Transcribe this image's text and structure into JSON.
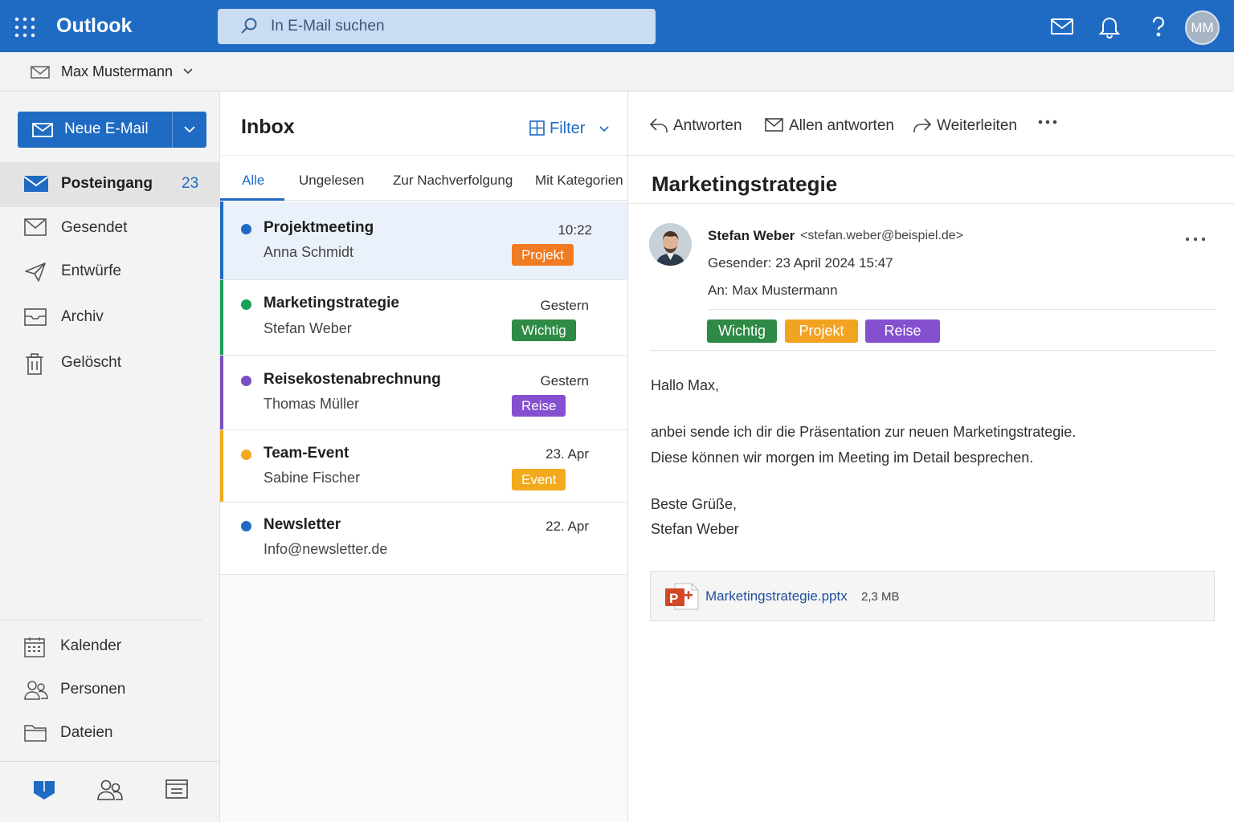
{
  "app": {
    "title": "Outlook"
  },
  "search": {
    "placeholder": "In E-Mail suchen"
  },
  "user": {
    "initials": "MM",
    "name": "Max Mustermann"
  },
  "nav": {
    "new_mail_label": "Neue E-Mail",
    "folders": [
      {
        "label": "Posteingang",
        "count": "23",
        "icon": "inbox-icon"
      },
      {
        "label": "Gesendet",
        "icon": "sent-icon"
      },
      {
        "label": "Entwürfe",
        "icon": "drafts-icon"
      },
      {
        "label": "Archiv",
        "icon": "archive-icon"
      },
      {
        "label": "Gelöscht",
        "icon": "trash-icon"
      }
    ],
    "apps": [
      {
        "label": "Kalender",
        "icon": "calendar-icon"
      },
      {
        "label": "Personen",
        "icon": "people-icon"
      },
      {
        "label": "Dateien",
        "icon": "folder-icon"
      }
    ]
  },
  "list": {
    "title": "Inbox",
    "filter_label": "Filter",
    "tabs": [
      "Alle",
      "Ungelesen",
      "Zur Nachverfolgung",
      "Mit Kategorien"
    ],
    "messages": [
      {
        "subject": "Projektmeeting",
        "sender": "Anna Schmidt",
        "time": "10:22",
        "tag": "Projekt",
        "color": "#1f6bc4",
        "tag_color": "#f07b22"
      },
      {
        "subject": "Marketingstrategie",
        "sender": "Stefan Weber",
        "time": "Gestern",
        "tag": "Wichtig",
        "color": "#17a25a",
        "tag_color": "#2e8a45"
      },
      {
        "subject": "Reisekostenabrechnung",
        "sender": "Thomas Müller",
        "time": "Gestern",
        "tag": "Reise",
        "color": "#7a4fc0",
        "tag_color": "#8450d0"
      },
      {
        "subject": "Team-Event",
        "sender": "Sabine Fischer",
        "time": "23. Apr",
        "tag": "Event",
        "color": "#f2aa1c",
        "tag_color": "#f2aa1c"
      },
      {
        "subject": "Newsletter",
        "sender": "Info@newsletter.de",
        "time": "22. Apr",
        "color": "#1f6bc4"
      }
    ]
  },
  "reading": {
    "actions": {
      "reply": "Antworten",
      "reply_all": "Allen antworten",
      "forward": "Weiterleiten"
    },
    "subject": "Marketingstrategie",
    "sender_name": "Stefan Weber",
    "sender_email": "<stefan.weber@beispiel.de>",
    "sent": "Gesender: 23 April 2024 15:47",
    "to": "An: Max Mustermann",
    "tags": [
      {
        "label": "Wichtig",
        "color": "#2e8a45"
      },
      {
        "label": "Projekt",
        "color": "#f2a322"
      },
      {
        "label": "Reise",
        "color": "#8450d0"
      }
    ],
    "body": {
      "greeting": "Hallo Max,",
      "line1": "anbei sende ich dir die Präsentation zur neuen Marketingstrategie.",
      "line2": "Diese können wir morgen im Meeting im Detail besprechen.",
      "closing": "Beste Grüße,",
      "signature": "Stefan Weber"
    },
    "attachment": {
      "name": "Marketingstrategie.pptx",
      "size": "2,3 MB",
      "icon": "powerpoint-icon"
    }
  }
}
